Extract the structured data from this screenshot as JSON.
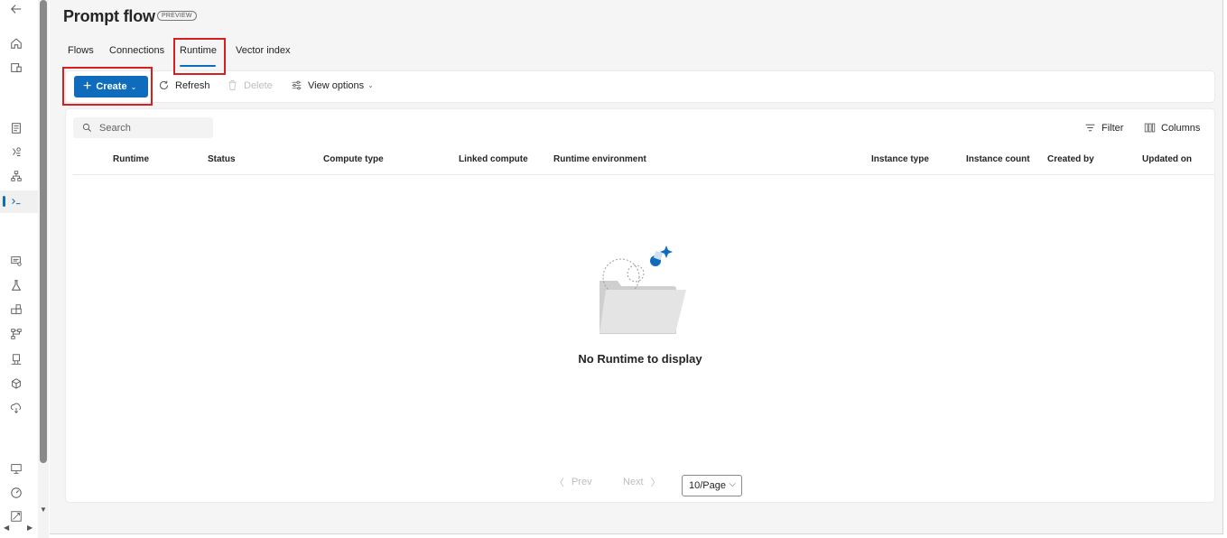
{
  "header": {
    "title": "Prompt flow",
    "badge": "PREVIEW"
  },
  "tabs": [
    {
      "label": "Flows"
    },
    {
      "label": "Connections"
    },
    {
      "label": "Runtime",
      "active": true
    },
    {
      "label": "Vector index"
    }
  ],
  "commands": {
    "create_label": "Create",
    "refresh_label": "Refresh",
    "delete_label": "Delete",
    "view_options_label": "View options"
  },
  "toolbar": {
    "search_placeholder": "Search",
    "filter_label": "Filter",
    "columns_label": "Columns"
  },
  "table": {
    "columns": [
      "Runtime",
      "Status",
      "Compute type",
      "Linked compute",
      "Runtime environment",
      "Instance type",
      "Instance count",
      "Created by",
      "Updated on"
    ],
    "rows": []
  },
  "empty_state": {
    "message": "No Runtime to display"
  },
  "pagination": {
    "prev_label": "Prev",
    "next_label": "Next",
    "page_size": "10/Page"
  },
  "sidebar": {
    "icons": [
      "back-arrow-icon",
      "home-icon",
      "model-catalog-icon",
      "notebook-icon",
      "automl-icon",
      "designer-icon",
      "prompt-flow-icon",
      "data-icon",
      "jobs-icon",
      "components-icon",
      "pipelines-icon",
      "environments-icon",
      "models-icon",
      "endpoints-icon",
      "compute-icon",
      "monitoring-icon",
      "data-labeling-icon"
    ]
  },
  "colors": {
    "accent": "#0f6cbd",
    "highlight_box": "#d81e1e",
    "background": "#f5f5f5"
  }
}
